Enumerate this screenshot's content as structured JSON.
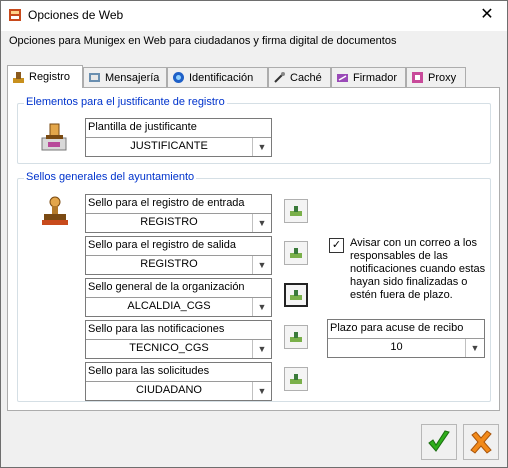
{
  "window": {
    "title": "Opciones de Web",
    "close_icon": "close-icon"
  },
  "subtitle": "Opciones para Munigex en Web para ciudadanos y firma digital de documentos",
  "tabs": [
    {
      "label": "Registro",
      "icon": "registro-icon",
      "active": true
    },
    {
      "label": "Mensajería",
      "icon": "mensajeria-icon",
      "active": false
    },
    {
      "label": "Identificación",
      "icon": "identificacion-icon",
      "active": false
    },
    {
      "label": "Caché",
      "icon": "cache-icon",
      "active": false
    },
    {
      "label": "Firmador",
      "icon": "firmador-icon",
      "active": false
    },
    {
      "label": "Proxy",
      "icon": "proxy-icon",
      "active": false
    }
  ],
  "group_justificante": {
    "title": "Elementos para el justificante de registro",
    "plantilla": {
      "label": "Plantilla de justificante",
      "value": "JUSTIFICANTE"
    }
  },
  "group_sellos": {
    "title": "Sellos generales del ayuntamiento",
    "fields": [
      {
        "label": "Sello para el registro de entrada",
        "value": "REGISTRO"
      },
      {
        "label": "Sello para el registro de salida",
        "value": "REGISTRO"
      },
      {
        "label": "Sello general de la organización",
        "value": "ALCALDIA_CGS"
      },
      {
        "label": "Sello para las notificaciones",
        "value": "TECNICO_CGS"
      },
      {
        "label": "Sello para las solicitudes",
        "value": "CIUDADANO"
      }
    ],
    "aviso": {
      "checked": true,
      "text": "Avisar con un correo a los responsables de las notificaciones cuando estas hayan sido finalizadas o estén fuera de plazo."
    },
    "plazo": {
      "label": "Plazo para acuse de recibo",
      "value": "10"
    }
  },
  "buttons": {
    "accept_icon": "checkmark-icon",
    "cancel_icon": "cancel-x-icon"
  },
  "colors": {
    "group_title": "#0033cc",
    "accept": "#2fae1c",
    "cancel": "#f28a1a"
  }
}
